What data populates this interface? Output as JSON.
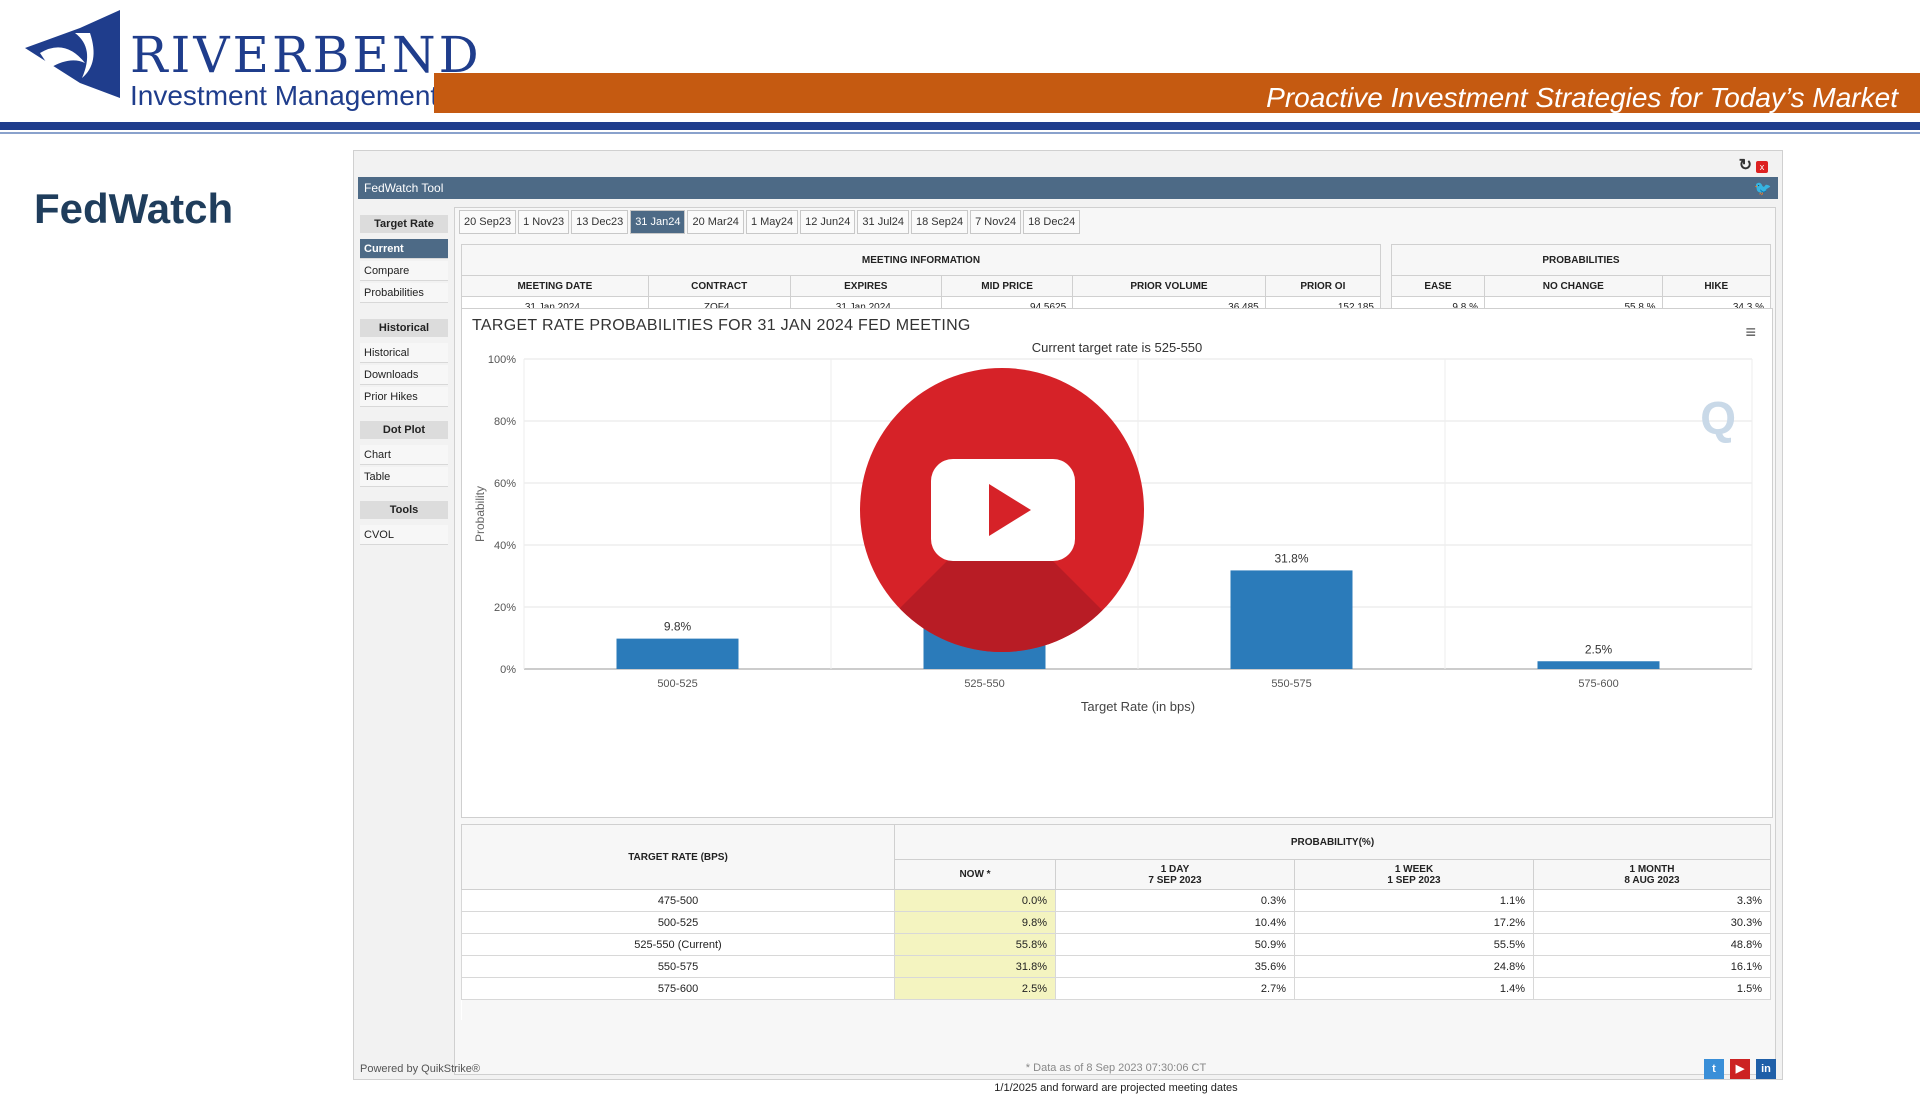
{
  "header": {
    "brand_name": "RIVERBEND",
    "brand_sub": "Investment Management",
    "tagline": "Proactive Investment Strategies for Today’s Market",
    "slide_title": "FedWatch"
  },
  "tool": {
    "title": "FedWatch Tool",
    "sidebar": {
      "sections": [
        {
          "heading": "Target Rate",
          "items": [
            "Current",
            "Compare",
            "Probabilities"
          ]
        },
        {
          "heading": "Historical",
          "items": [
            "Historical",
            "Downloads",
            "Prior Hikes"
          ]
        },
        {
          "heading": "Dot Plot",
          "items": [
            "Chart",
            "Table"
          ]
        },
        {
          "heading": "Tools",
          "items": [
            "CVOL"
          ]
        }
      ]
    },
    "tabs": [
      "20 Sep23",
      "1 Nov23",
      "13 Dec23",
      "31 Jan24",
      "20 Mar24",
      "1 May24",
      "12 Jun24",
      "31 Jul24",
      "18 Sep24",
      "7 Nov24",
      "18 Dec24"
    ],
    "active_tab": "31 Jan24",
    "meeting_info": {
      "heading": "MEETING INFORMATION",
      "columns": [
        "MEETING DATE",
        "CONTRACT",
        "EXPIRES",
        "MID PRICE",
        "PRIOR VOLUME",
        "PRIOR OI"
      ],
      "row": [
        "31 Jan 2024",
        "ZQF4",
        "31 Jan 2024",
        "94.5625",
        "36,485",
        "152,185"
      ]
    },
    "probabilities": {
      "heading": "PROBABILITIES",
      "columns": [
        "EASE",
        "NO CHANGE",
        "HIKE"
      ],
      "row": [
        "9.8 %",
        "55.8 %",
        "34.3 %"
      ]
    },
    "chart_data": {
      "type": "bar",
      "title": "TARGET RATE PROBABILITIES FOR 31 JAN 2024 FED MEETING",
      "subtitle": "Current target rate is 525-550",
      "categories": [
        "500-525",
        "525-550",
        "550-575",
        "575-600"
      ],
      "values": [
        9.8,
        55.8,
        31.8,
        2.5
      ],
      "data_labels": [
        "9.8%",
        "55.8%",
        "31.8%",
        "2.5%"
      ],
      "xlabel": "Target Rate (in bps)",
      "ylabel": "Probability",
      "ylim": [
        0,
        100
      ],
      "yticks": [
        "0%",
        "20%",
        "40%",
        "60%",
        "80%",
        "100%"
      ],
      "grid": true,
      "color": "#2b7bba"
    },
    "rate_table": {
      "rate_header": "TARGET RATE (BPS)",
      "prob_header": "PROBABILITY(%)",
      "col_now": "NOW *",
      "col_1day": [
        "1 DAY",
        "7 SEP 2023"
      ],
      "col_1week": [
        "1 WEEK",
        "1 SEP 2023"
      ],
      "col_1month": [
        "1 MONTH",
        "8 AUG 2023"
      ],
      "rows": [
        {
          "rate": "475-500",
          "now": "0.0%",
          "day": "0.3%",
          "week": "1.1%",
          "month": "3.3%"
        },
        {
          "rate": "500-525",
          "now": "9.8%",
          "day": "10.4%",
          "week": "17.2%",
          "month": "30.3%"
        },
        {
          "rate": "525-550 (Current)",
          "now": "55.8%",
          "day": "50.9%",
          "week": "55.5%",
          "month": "48.8%"
        },
        {
          "rate": "550-575",
          "now": "31.8%",
          "day": "35.6%",
          "week": "24.8%",
          "month": "16.1%"
        },
        {
          "rate": "575-600",
          "now": "2.5%",
          "day": "2.7%",
          "week": "1.4%",
          "month": "1.5%"
        }
      ],
      "data_asof": "* Data as of 8 Sep 2023 07:30:06 CT",
      "projected_note": "1/1/2025 and forward are projected meeting dates"
    },
    "powered_by": "Powered by QuikStrike®",
    "social": [
      "twitter-icon",
      "youtube-icon",
      "linkedin-icon"
    ]
  }
}
